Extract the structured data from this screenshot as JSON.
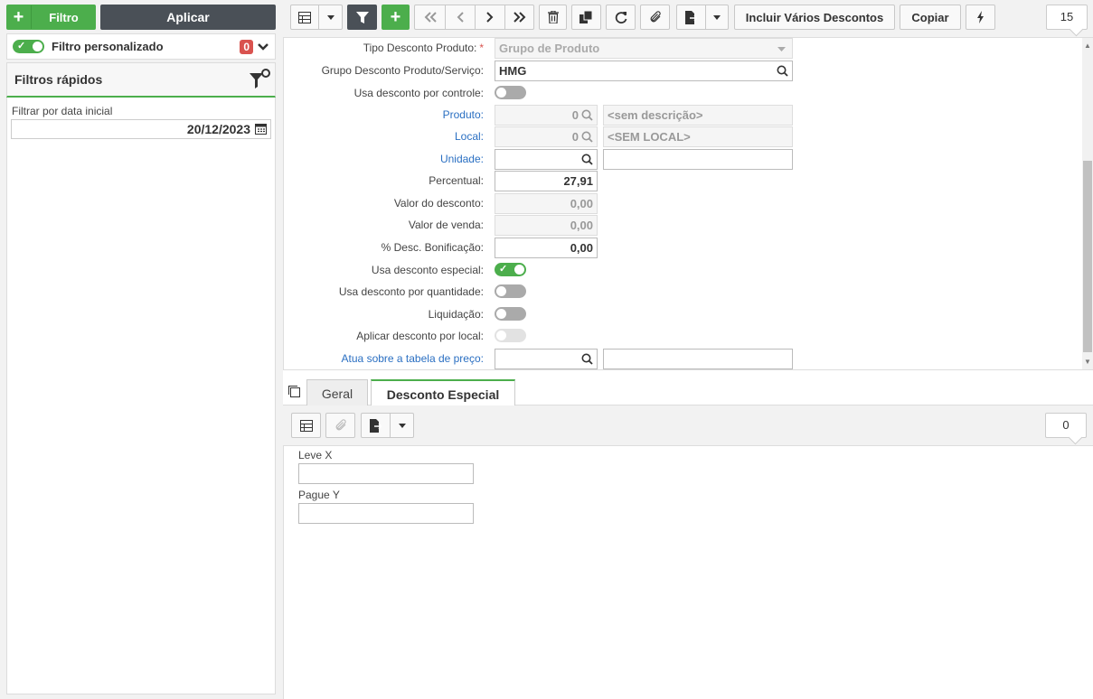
{
  "left": {
    "filtro_label": "Filtro",
    "aplicar_label": "Aplicar",
    "custom_filter_label": "Filtro personalizado",
    "custom_filter_count": "0",
    "quick_filters_title": "Filtros rápidos",
    "date_filter_label": "Filtrar por data inicial",
    "date_filter_value": "20/12/2023"
  },
  "toolbar": {
    "incluir_label": "Incluir Vários Descontos",
    "copiar_label": "Copiar",
    "page_size": "15"
  },
  "form": {
    "tipo_desconto_label": "Tipo Desconto Produto:",
    "tipo_desconto_value": "Grupo de Produto",
    "grupo_label": "Grupo Desconto Produto/Serviço:",
    "grupo_value": "HMG",
    "usa_controle_label": "Usa desconto por controle:",
    "produto_label": "Produto:",
    "produto_code": "0",
    "produto_desc": "<sem descrição>",
    "local_label": "Local:",
    "local_code": "0",
    "local_desc": "<SEM LOCAL>",
    "unidade_label": "Unidade:",
    "percentual_label": "Percentual:",
    "percentual_value": "27,91",
    "valor_desconto_label": "Valor do desconto:",
    "valor_desconto_value": "0,00",
    "valor_venda_label": "Valor de venda:",
    "valor_venda_value": "0,00",
    "desc_bonif_label": "% Desc. Bonificação:",
    "desc_bonif_value": "0,00",
    "usa_especial_label": "Usa desconto especial:",
    "usa_quantidade_label": "Usa desconto por quantidade:",
    "liquidacao_label": "Liquidação:",
    "aplicar_local_label": "Aplicar desconto por local:",
    "atua_tabela_label": "Atua sobre a tabela de preço:"
  },
  "tabs": {
    "geral": "Geral",
    "desconto_especial": "Desconto Especial"
  },
  "subbar": {
    "page_size": "0"
  },
  "subform": {
    "leve_label": "Leve X",
    "pague_label": "Pague Y"
  },
  "colors": {
    "accent_green": "#4cae4c",
    "dark_button": "#4a5057",
    "badge_red": "#d9534f",
    "link_blue": "#2a6fc2"
  },
  "icons": [
    "plus-icon",
    "check-icon",
    "chevron-down-icon",
    "filter-settings-icon",
    "calendar-icon",
    "grid-icon",
    "caret-down-icon",
    "filter-icon",
    "first-page-icon",
    "prev-page-icon",
    "next-page-icon",
    "last-page-icon",
    "trash-icon",
    "copy-docs-icon",
    "refresh-icon",
    "paperclip-icon",
    "export-icon",
    "lightning-icon",
    "search-icon",
    "restore-window-icon"
  ]
}
